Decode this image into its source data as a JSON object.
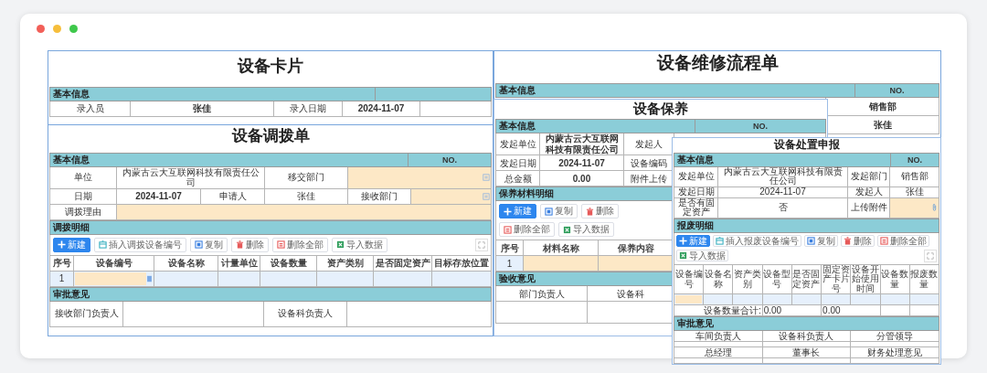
{
  "card_form": {
    "title": "设备卡片",
    "section": "基本信息",
    "fields": [
      {
        "label": "录入员",
        "value": "张佳"
      },
      {
        "label": "录入日期",
        "value": "2024-11-07"
      }
    ]
  },
  "transfer_form": {
    "title": "设备调拨单",
    "section": "基本信息",
    "no_label": "NO.",
    "rows": [
      {
        "label": "单位",
        "value": "内蒙古云大互联网科技有限责任公司",
        "label_2": "移交部门"
      },
      {
        "label": "日期",
        "value": "2024-11-07",
        "label_2": "申请人",
        "value_2": "张佳",
        "label_3": "接收部门"
      },
      {
        "label": "调拨理由"
      }
    ],
    "detail_section": "调拨明细",
    "toolbar": [
      {
        "label": "新建",
        "kind": "primary"
      },
      {
        "label": "插入调拨设备编号",
        "kind": "insert"
      },
      {
        "label": "复制",
        "kind": "copy"
      },
      {
        "label": "删除",
        "kind": "delete"
      },
      {
        "label": "删除全部",
        "kind": "delete_all"
      },
      {
        "label": "导入数据",
        "kind": "import"
      }
    ],
    "columns": [
      "序号",
      "设备编号",
      "设备名称",
      "计量单位",
      "设备数量",
      "资产类别",
      "是否固定资产",
      "目标存放位置"
    ],
    "detail_rows": [
      {
        "index": "1"
      }
    ],
    "approval_section": "审批意见",
    "approvers": [
      "接收部门负责人",
      "设备科负责人"
    ]
  },
  "repair_form": {
    "title": "设备维修流程单",
    "section": "基本信息",
    "no_label": "NO.",
    "values": [
      "销售部",
      "张佳"
    ]
  },
  "maintenance_form": {
    "title": "设备保养",
    "section": "基本信息",
    "no_label": "NO.",
    "rows": [
      {
        "label": "发起单位",
        "value": "内蒙古云大互联网科技有限责任公司",
        "label_2": "发起人"
      },
      {
        "label": "发起日期",
        "value": "2024-11-07",
        "label_2": "设备编码"
      },
      {
        "label": "总金额",
        "value": "0.00",
        "label_2": "附件上传"
      }
    ],
    "detail_section": "保养材料明细",
    "toolbar": [
      {
        "label": "新建",
        "kind": "primary"
      },
      {
        "label": "复制",
        "kind": "copy"
      },
      {
        "label": "删除",
        "kind": "delete"
      },
      {
        "label": "删除全部",
        "kind": "delete_all"
      },
      {
        "label": "导入数据",
        "kind": "import"
      }
    ],
    "columns": [
      "序号",
      "材料名称",
      "保养内容"
    ],
    "detail_rows": [
      {
        "index": "1"
      }
    ],
    "approval_section": "验收意见",
    "approvers": [
      "部门负责人",
      "设备科"
    ]
  },
  "disposal_form": {
    "title": "设备处置申报",
    "section": "基本信息",
    "no_label": "NO.",
    "rows": [
      {
        "label": "发起单位",
        "value": "内蒙古云大互联网科技有限责任公司",
        "label_2": "发起部门",
        "value_2": "销售部"
      },
      {
        "label": "发起日期",
        "value": "2024-11-07",
        "label_2": "发起人",
        "value_2": "张佳"
      },
      {
        "label": "是否有固定资产",
        "value": "否",
        "label_2": "上传附件"
      }
    ],
    "detail_section": "报废明细",
    "toolbar": [
      {
        "label": "新建",
        "kind": "primary"
      },
      {
        "label": "插入报废设备编号",
        "kind": "insert"
      },
      {
        "label": "复制",
        "kind": "copy"
      },
      {
        "label": "删除",
        "kind": "delete"
      },
      {
        "label": "删除全部",
        "kind": "delete_all"
      },
      {
        "label": "导入数据",
        "kind": "import"
      }
    ],
    "columns": [
      "设备编号",
      "设备名称",
      "资产类别",
      "设备型号",
      "是否固定资产",
      "固定资产卡片号",
      "设备开始使用时间",
      "设备数量",
      "报废数量"
    ],
    "total_label": "设备数量合计:",
    "totals": [
      "0.00",
      "0.00"
    ],
    "approval_section": "审批意见",
    "approvers": [
      "车间负责人",
      "设备科负责人",
      "分管领导",
      "总经理",
      "董事长",
      "财务处理意见"
    ]
  }
}
